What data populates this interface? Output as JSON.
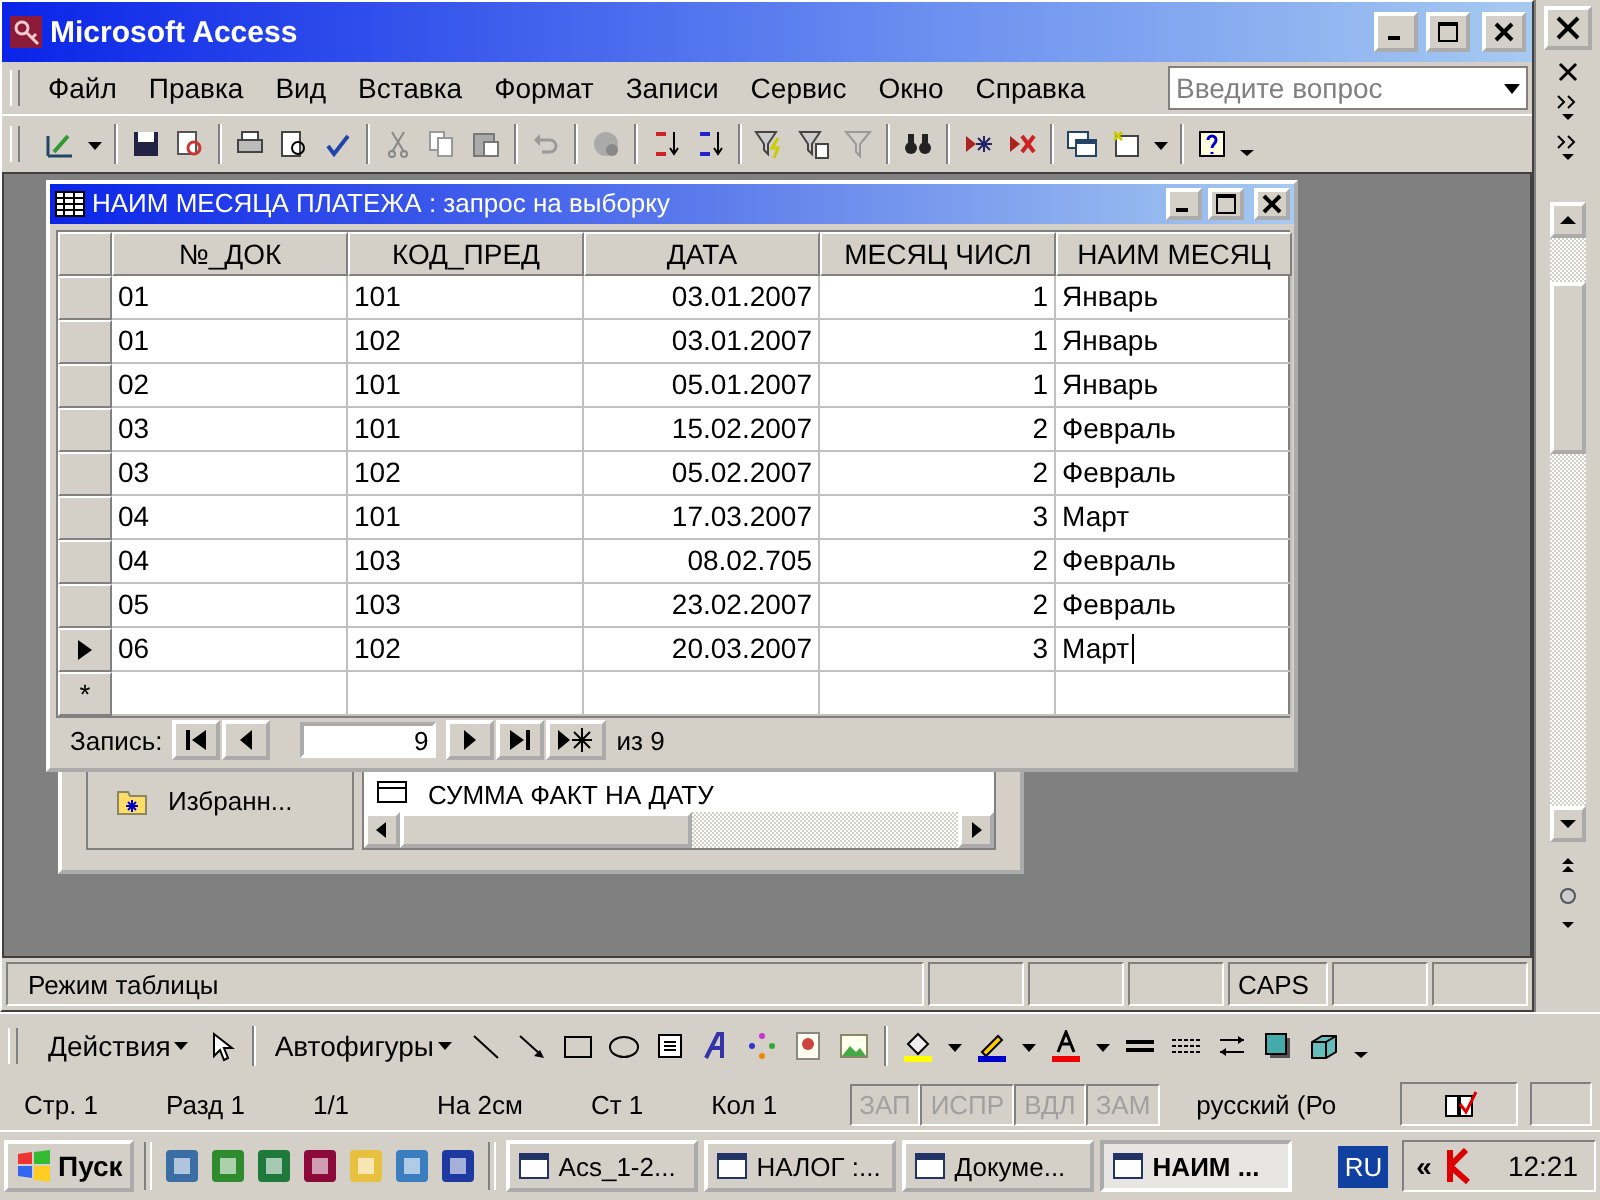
{
  "app_window": {
    "title": "Microsoft Access"
  },
  "menu": [
    "Файл",
    "Правка",
    "Вид",
    "Вставка",
    "Формат",
    "Записи",
    "Сервис",
    "Окно",
    "Справка"
  ],
  "help_search": {
    "placeholder": "Введите вопрос"
  },
  "query_window": {
    "title": "НАИМ МЕСЯЦА ПЛАТЕЖА : запрос на выборку",
    "columns": [
      {
        "label": "№_ДОК",
        "kind": "text"
      },
      {
        "label": "КОД_ПРЕД",
        "kind": "text"
      },
      {
        "label": "ДАТА",
        "kind": "number"
      },
      {
        "label": "МЕСЯЦ ЧИСЛ",
        "kind": "number"
      },
      {
        "label": "НАИМ МЕСЯЦ",
        "kind": "text"
      }
    ],
    "rows": [
      {
        "cells": [
          "01",
          "101",
          "03.01.2007",
          "1",
          "Январь"
        ],
        "current": false
      },
      {
        "cells": [
          "01",
          "102",
          "03.01.2007",
          "1",
          "Январь"
        ],
        "current": false
      },
      {
        "cells": [
          "02",
          "101",
          "05.01.2007",
          "1",
          "Январь"
        ],
        "current": false
      },
      {
        "cells": [
          "03",
          "101",
          "15.02.2007",
          "2",
          "Февраль"
        ],
        "current": false
      },
      {
        "cells": [
          "03",
          "102",
          "05.02.2007",
          "2",
          "Февраль"
        ],
        "current": false
      },
      {
        "cells": [
          "04",
          "101",
          "17.03.2007",
          "3",
          "Март"
        ],
        "current": false
      },
      {
        "cells": [
          "04",
          "103",
          "08.02.705",
          "2",
          "Февраль"
        ],
        "current": false
      },
      {
        "cells": [
          "05",
          "103",
          "23.02.2007",
          "2",
          "Февраль"
        ],
        "current": false
      },
      {
        "cells": [
          "06",
          "102",
          "20.03.2007",
          "3",
          "Март"
        ],
        "current": true
      }
    ],
    "new_row_marker": "*",
    "navigator": {
      "label": "Запись:",
      "value": "9",
      "total": "из 9"
    }
  },
  "database_window": {
    "group": "Избранн...",
    "item": "СУММА ФАКТ НА ДАТУ"
  },
  "status_bar": {
    "mode": "Режим таблицы",
    "caps": "CAPS"
  },
  "drawing_toolbar": {
    "actions": "Действия",
    "autoshapes": "Автофигуры"
  },
  "word_status": [
    {
      "label": "Стр. 1",
      "disabled": false
    },
    {
      "label": "Разд 1",
      "disabled": false
    },
    {
      "label": "1/1",
      "disabled": false
    },
    {
      "label": "На 2см",
      "disabled": false
    },
    {
      "label": "Ст 1",
      "disabled": false
    },
    {
      "label": "Кол 1",
      "disabled": false
    },
    {
      "label": "ЗАП",
      "disabled": true
    },
    {
      "label": "ИСПР",
      "disabled": true
    },
    {
      "label": "ВДЛ",
      "disabled": true
    },
    {
      "label": "ЗАМ",
      "disabled": true
    },
    {
      "label": "русский (Ро",
      "disabled": false
    }
  ],
  "taskbar": {
    "start": "Пуск",
    "tasks": [
      {
        "label": "Acs_1-2...",
        "selected": false
      },
      {
        "label": "НАЛОГ :...",
        "selected": false
      },
      {
        "label": "Докуме...",
        "selected": false
      },
      {
        "label": "НАИМ ...",
        "selected": true
      }
    ],
    "language": "RU",
    "tray_arrow": "«",
    "clock": "12:21"
  }
}
